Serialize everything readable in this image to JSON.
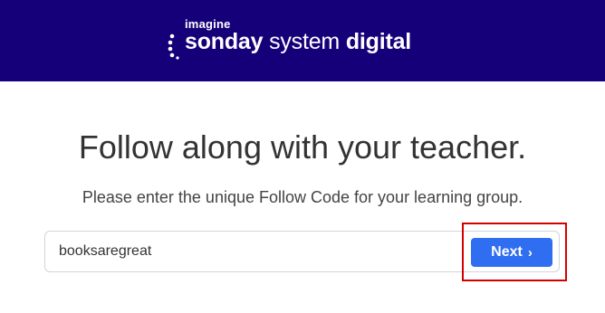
{
  "header": {
    "logo_small": "imagine",
    "logo_word1": "sonday",
    "logo_word2": "system",
    "logo_word3": "digital",
    "background": "#16007a"
  },
  "main": {
    "title": "Follow along with your teacher.",
    "instruction": "Please enter the unique Follow Code for your learning group.",
    "code_input": {
      "value": "booksaregreat",
      "placeholder": ""
    },
    "next_button": {
      "label": "Next",
      "icon": "chevron-right-icon",
      "color": "#2f6ef0"
    }
  },
  "highlight": {
    "color": "#d40000",
    "target": "next-button"
  }
}
